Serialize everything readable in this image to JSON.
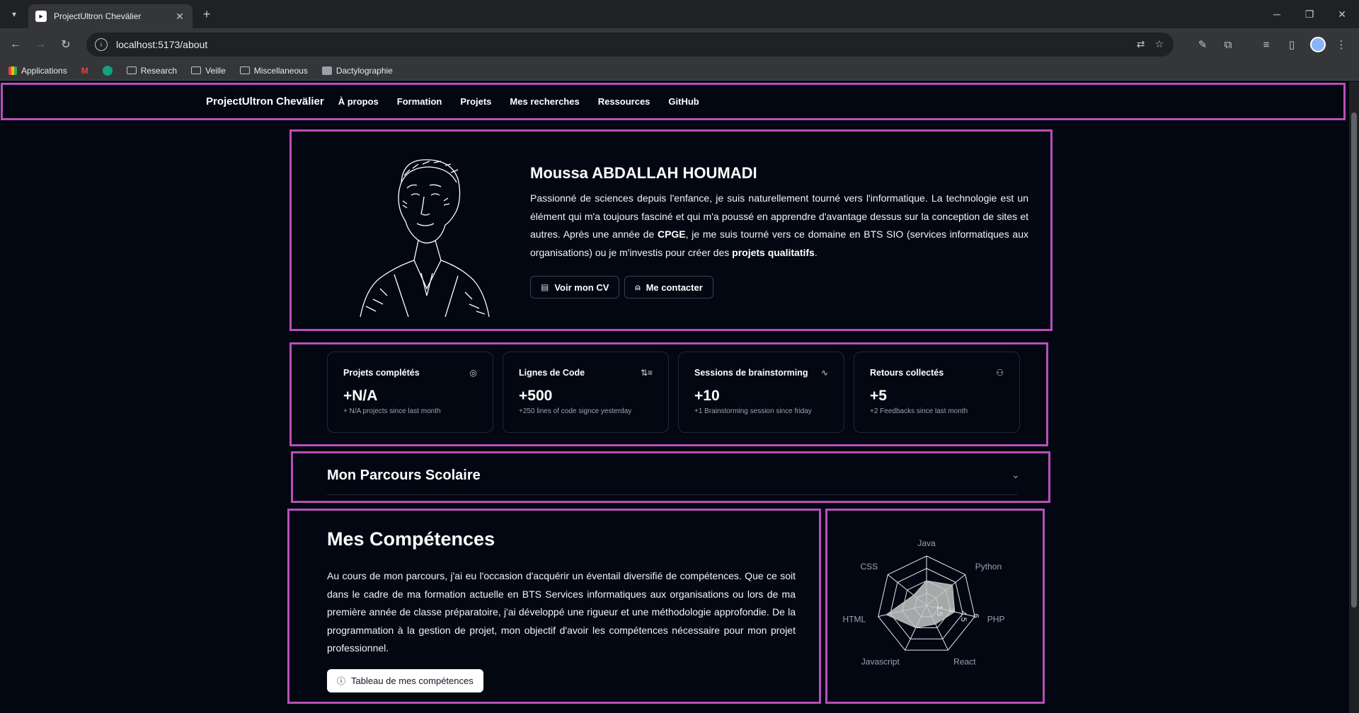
{
  "browser": {
    "tab_title": "ProjectUltron Chevälier",
    "tab_favicon": "project-ultron-icon",
    "new_tab": "+",
    "url": "localhost:5173/about",
    "bookmarks": [
      {
        "label": "Applications",
        "icon": "apps-grid-icon"
      },
      {
        "label": "",
        "icon": "gmail-icon"
      },
      {
        "label": "",
        "icon": "chatgpt-icon"
      },
      {
        "label": "Research",
        "icon": "folder-icon"
      },
      {
        "label": "Veille",
        "icon": "folder-icon"
      },
      {
        "label": "Miscellaneous",
        "icon": "folder-icon"
      },
      {
        "label": "Dactylographie",
        "icon": "bookmark-icon"
      }
    ]
  },
  "nav": {
    "brand": "ProjectUltron Chevälier",
    "links": [
      "À propos",
      "Formation",
      "Projets",
      "Mes recherches",
      "Ressources",
      "GitHub"
    ]
  },
  "hero": {
    "name": "Moussa ABDALLAH HOUMADI",
    "text_1": "Passionné de sciences depuis l'enfance, je suis naturellement tourné vers l'informatique. La technologie est un élément qui m'a toujours fasciné et qui m'a poussé en apprendre d'avantage dessus sur la conception de sites et autres. Après une année de ",
    "text_bold_1": "CPGE",
    "text_2": ", je me suis tourné vers ce domaine en BTS SIO (services informatiques aux organisations) ou je m'investis pour créer des ",
    "text_bold_2": "projets qualitatifs",
    "text_3": ".",
    "cv_button": "Voir mon CV",
    "contact_button": "Me contacter"
  },
  "stats": [
    {
      "label": "Projets complétés",
      "value": "+N/A",
      "sub": "+ N/A projects since last month",
      "icon": "check-circle-icon"
    },
    {
      "label": "Lignes de Code",
      "value": "+500",
      "sub": "+250 lines of code signce yesterday",
      "icon": "list-ordered-icon"
    },
    {
      "label": "Sessions de brainstorming",
      "value": "+10",
      "sub": "+1 Brainstorming session since friday",
      "icon": "activity-icon"
    },
    {
      "label": "Retours collectés",
      "value": "+5",
      "sub": "+2 Feedbacks since last month",
      "icon": "users-icon"
    }
  ],
  "parcours": {
    "title": "Mon Parcours Scolaire"
  },
  "skills": {
    "title": "Mes Compétences",
    "text": "Au cours de mon parcours, j'ai eu l'occasion d'acquérir un éventail diversifié de compétences. Que ce soit dans le cadre de ma formation actuelle en BTS Services informatiques aux organisations ou lors de ma première année de classe préparatoire, j'ai développé une rigueur et une méthodologie approfondie. De la programmation à la gestion de projet, mon objectif d'avoir les compétences nécessaire pour mon projet professionnel.",
    "button": "Tableau de mes compétences"
  },
  "chart_data": {
    "type": "radar",
    "categories": [
      "Java",
      "Python",
      "PHP",
      "React",
      "Javascript",
      "HTML",
      "CSS"
    ],
    "values": [
      3,
      4,
      3.5,
      2.5,
      3,
      5,
      2
    ],
    "rlim": [
      0,
      6
    ],
    "tick_labels": [
      "1.5",
      "3",
      "4.5",
      "6"
    ],
    "colors": {
      "fill": "#c4c4c4",
      "grid": "#e5e7eb",
      "label": "#9ca3af"
    }
  }
}
